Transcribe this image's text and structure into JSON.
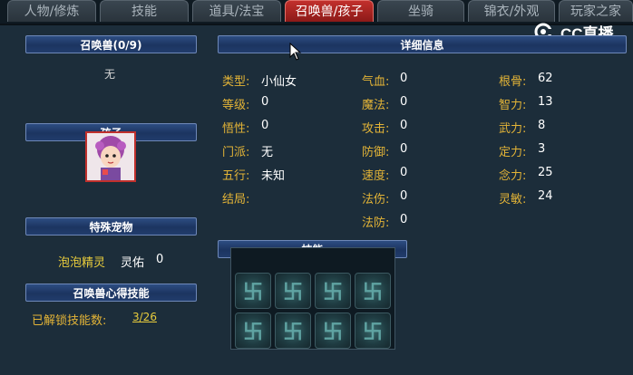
{
  "tabs": [
    {
      "label": "人物/修炼",
      "active": false
    },
    {
      "label": "技能",
      "active": false
    },
    {
      "label": "道具/法宝",
      "active": false
    },
    {
      "label": "召唤兽/孩子",
      "active": true
    },
    {
      "label": "坐骑",
      "active": false
    },
    {
      "label": "锦衣/外观",
      "active": false
    },
    {
      "label": "玩家之家",
      "active": false
    }
  ],
  "logo": {
    "text": "CC直播"
  },
  "left": {
    "summon_header": "召唤兽(0/9)",
    "summon_value": "无",
    "child_header": "孩子",
    "special_header": "特殊宠物",
    "pet_name": "泡泡精灵",
    "pet_skill": "灵佑",
    "pet_count": "0",
    "summon_skill_header": "召唤兽心得技能",
    "unlocked_label": "已解锁技能数:",
    "unlocked_value": "3/26"
  },
  "detail": {
    "header": "详细信息",
    "col1": [
      {
        "label": "类型:",
        "value": "小仙女"
      },
      {
        "label": "等级:",
        "value": "0"
      },
      {
        "label": "悟性:",
        "value": "0"
      },
      {
        "label": "门派:",
        "value": "无"
      },
      {
        "label": "五行:",
        "value": "未知"
      },
      {
        "label": "结局:",
        "value": ""
      }
    ],
    "col2": [
      {
        "label": "气血:",
        "value": "0"
      },
      {
        "label": "魔法:",
        "value": "0"
      },
      {
        "label": "攻击:",
        "value": "0"
      },
      {
        "label": "防御:",
        "value": "0"
      },
      {
        "label": "速度:",
        "value": "0"
      },
      {
        "label": "法伤:",
        "value": "0"
      },
      {
        "label": "法防:",
        "value": "0"
      }
    ],
    "col3": [
      {
        "label": "根骨:",
        "value": "62"
      },
      {
        "label": "智力:",
        "value": "13"
      },
      {
        "label": "武力:",
        "value": "8"
      },
      {
        "label": "定力:",
        "value": "3"
      },
      {
        "label": "念力:",
        "value": "25"
      },
      {
        "label": "灵敏:",
        "value": "24"
      }
    ]
  },
  "skills": {
    "header": "技能",
    "slot_glyph": "卐"
  },
  "colors": {
    "accent_red": "#c2302c",
    "label_gold": "#e3b437",
    "header_blue": "#1c3460"
  }
}
